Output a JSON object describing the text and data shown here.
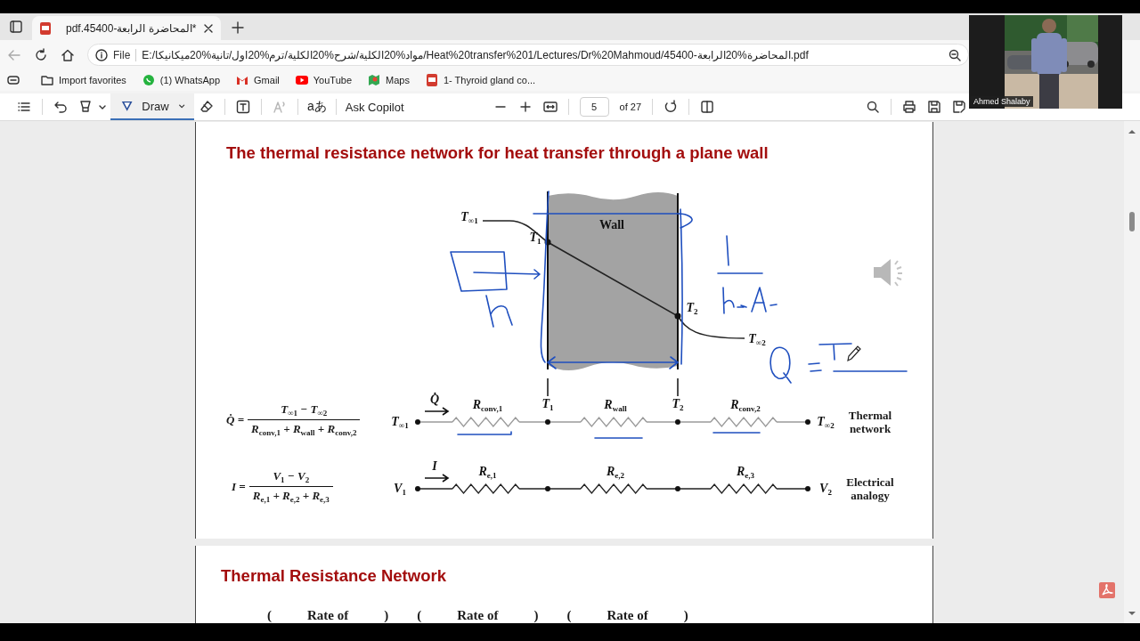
{
  "browser": {
    "tabs": [
      {
        "title": "*المحاضرة الرابعة-45400.pdf",
        "selected": true
      }
    ],
    "back": {
      "disabled": true
    },
    "address_bar": {
      "scheme": "File",
      "url": "E:/مواد%20الكلية/شرح%20الكلية/ترم%20اول/تانية%20ميكانيكا/Heat%20transfer%201/Lectures/Dr%20Mahmoud/المحاضرة%20الرابعة-45400.pdf"
    },
    "bookmarks": [
      {
        "label": "Import favorites",
        "kind": "folder"
      },
      {
        "label": "(1) WhatsApp",
        "kind": "chat"
      },
      {
        "label": "Gmail",
        "kind": "mail"
      },
      {
        "label": "YouTube",
        "kind": "video"
      },
      {
        "label": "Maps",
        "kind": "map"
      },
      {
        "label": "1- Thyroid gland co...",
        "kind": "pdf"
      }
    ]
  },
  "pdf_toolbar": {
    "draw": {
      "label": "Draw",
      "selected": true
    },
    "read_aloud": {
      "disabled": true
    },
    "translate": "aあ",
    "copilot": "Ask Copilot",
    "page": "5",
    "page_count": "of 27"
  },
  "document": {
    "pages": [
      {
        "heading": "The thermal resistance network for heat transfer through a plane wall",
        "figure": {
          "wall_label": "Wall",
          "profile_labels": [
            "T$_{∞1}$",
            "T$_{1}$",
            "T$_{2}$",
            "T$_{∞2}$"
          ]
        },
        "networks": [
          {
            "kind": "thermal",
            "equation": {
              "lhs": "Q̇ =",
              "numerator": "T$_{∞1}$ − T$_{∞2}$",
              "denominator": "R$_{conv,1}$ + R$_{wall}$ + R$_{conv,2}$"
            },
            "source": "T$_{∞1}$",
            "flow": "Q̇",
            "resistors": [
              "R$_{conv,1}$",
              "R$_{wall}$",
              "R$_{conv,2}$"
            ],
            "node_labels": [
              "T$_{1}$",
              "T$_{2}$"
            ],
            "sink": "T$_{∞2}$",
            "caption": "Thermal network"
          },
          {
            "kind": "electrical",
            "equation": {
              "lhs": "I =",
              "numerator": "V$_{1}$ − V$_{2}$",
              "denominator": "R$_{e,1}$ + R$_{e,2}$ + R$_{e,3}$"
            },
            "source": "V$_{1}$",
            "flow": "I",
            "resistors": [
              "R$_{e,1}$",
              "R$_{e,2}$",
              "R$_{e,3}$"
            ],
            "sink": "V$_{2}$",
            "caption": "Electrical analogy"
          }
        ]
      },
      {
        "heading": "Thermal Resistance Network",
        "terms": [
          {
            "open": "(",
            "text": "Rate of",
            "close": ")"
          },
          {
            "open": "(",
            "text": "Rate of",
            "close": ")"
          },
          {
            "open": "(",
            "text": "Rate of",
            "close": ")"
          }
        ]
      }
    ]
  },
  "video_call": {
    "kind": "picture",
    "participant": "Ahmed Shalaby"
  }
}
